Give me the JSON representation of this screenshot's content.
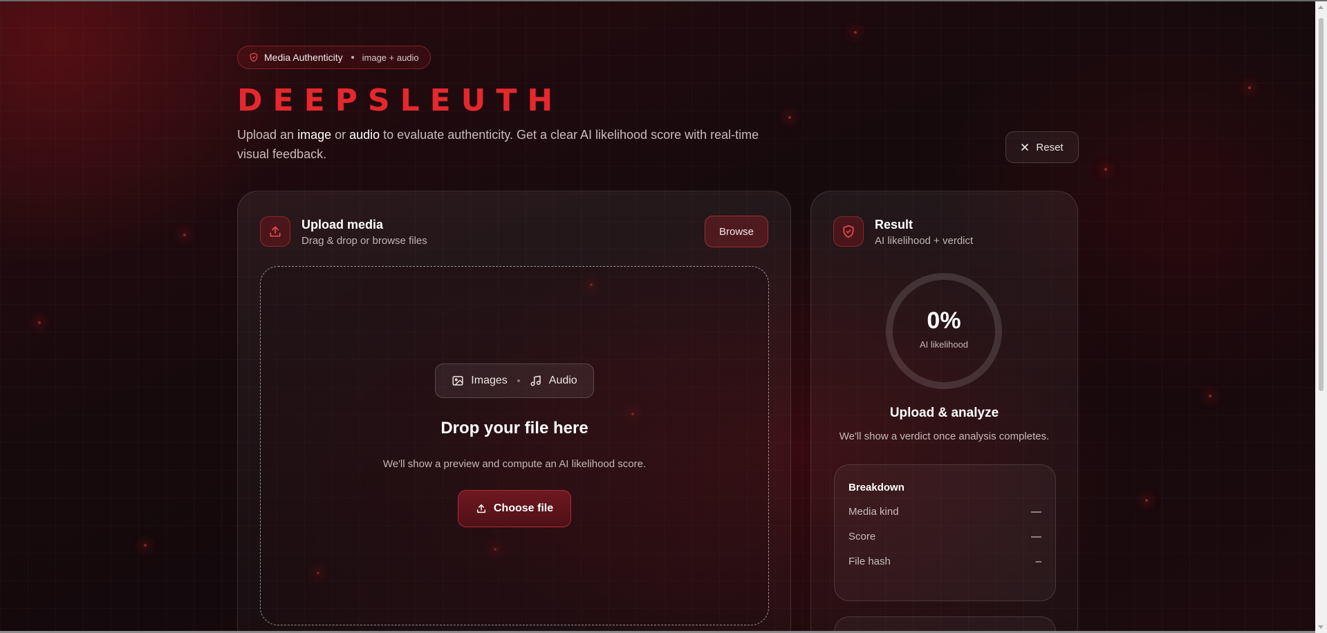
{
  "badge": {
    "label": "Media Authenticity",
    "sub": "image + audio",
    "icon": "shield-icon"
  },
  "header": {
    "title": "DEEPSLEUTH",
    "intro_prefix": "Upload an ",
    "intro_image": "image",
    "intro_or": " or ",
    "intro_audio": "audio",
    "intro_rest": " to evaluate authenticity. Get a clear AI likelihood score with real-time visual feedback.",
    "reset_label": "Reset"
  },
  "upload": {
    "title": "Upload media",
    "subtitle": "Drag & drop or browse files",
    "browse_label": "Browse",
    "chip_images": "Images",
    "chip_audio": "Audio",
    "drop_title": "Drop your file here",
    "drop_sub": "We'll show a preview and compute an AI likelihood score.",
    "choose_label": "Choose file"
  },
  "result": {
    "title": "Result",
    "subtitle": "AI likelihood + verdict",
    "percent": "0%",
    "percent_label": "AI likelihood",
    "likelihood_fraction": 0,
    "verdict_title": "Upload & analyze",
    "verdict_sub": "We'll show a verdict once analysis completes.",
    "breakdown": {
      "title": "Breakdown",
      "rows": [
        {
          "label": "Media kind",
          "value": "—"
        },
        {
          "label": "Score",
          "value": "—"
        },
        {
          "label": "File hash",
          "value": "–"
        }
      ]
    }
  },
  "colors": {
    "accent": "#e5282e",
    "background": "#170a0d"
  }
}
